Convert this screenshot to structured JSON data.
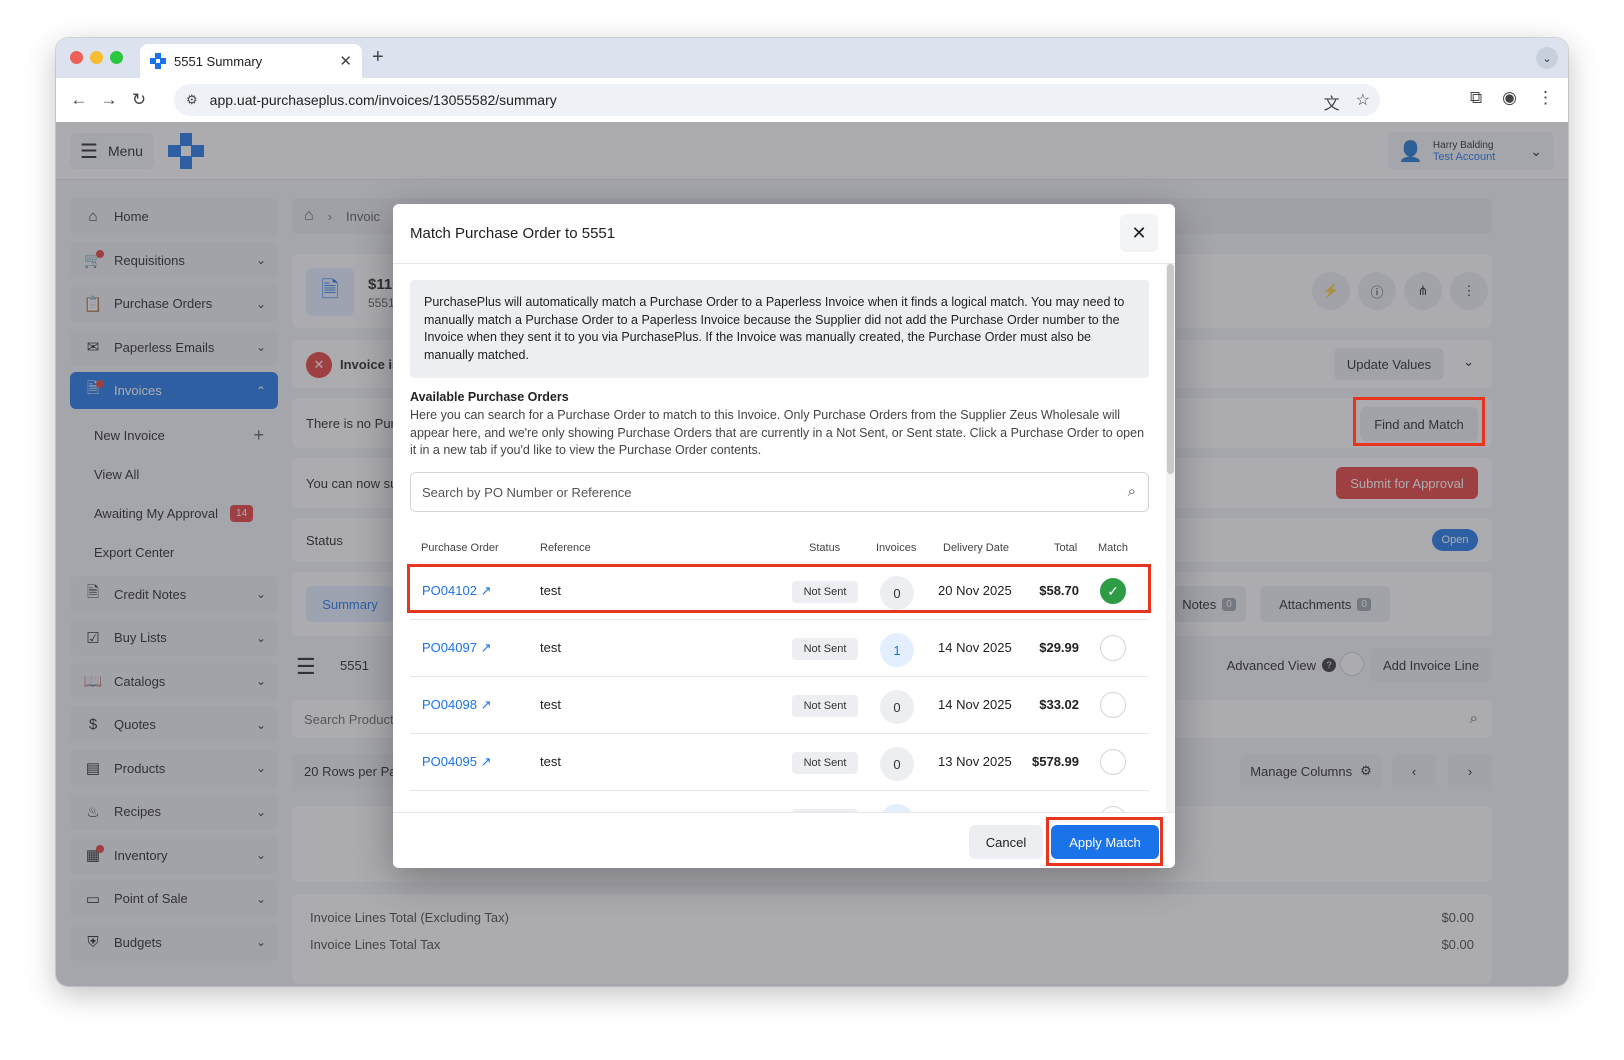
{
  "browser": {
    "tab_title": "5551 Summary",
    "url": "app.uat-purchaseplus.com/invoices/13055582/summary"
  },
  "header": {
    "menu_label": "Menu",
    "user_name": "Harry Balding",
    "user_account": "Test Account"
  },
  "sidebar": {
    "items": [
      {
        "label": "Home",
        "icon": "home-icon"
      },
      {
        "label": "Requisitions",
        "icon": "cart-icon"
      },
      {
        "label": "Purchase Orders",
        "icon": "clipboard-icon"
      },
      {
        "label": "Paperless Emails",
        "icon": "mail-icon"
      },
      {
        "label": "Invoices",
        "icon": "document-icon"
      },
      {
        "label": "Credit Notes",
        "icon": "document-icon"
      },
      {
        "label": "Buy Lists",
        "icon": "checklist-icon"
      },
      {
        "label": "Catalogs",
        "icon": "catalog-icon"
      },
      {
        "label": "Quotes",
        "icon": "dollar-icon"
      },
      {
        "label": "Products",
        "icon": "box-icon"
      },
      {
        "label": "Recipes",
        "icon": "chef-hat-icon"
      },
      {
        "label": "Inventory",
        "icon": "inventory-icon"
      },
      {
        "label": "Point of Sale",
        "icon": "pos-icon"
      },
      {
        "label": "Budgets",
        "icon": "shield-dollar-icon"
      }
    ],
    "invoice_sub": {
      "new_invoice": "New Invoice",
      "view_all": "View All",
      "awaiting": "Awaiting My Approval",
      "awaiting_count": "14",
      "export": "Export Center"
    }
  },
  "background": {
    "breadcrumb": "Invoic",
    "invoice_amount": "$110",
    "invoice_number": "5551",
    "error_text": "Invoice is",
    "update_values": "Update Values",
    "no_po_text": "There is no Pur",
    "find_and_match": "Find and Match",
    "submit_text": "You can now su",
    "submit_for_approval": "Submit for Approval",
    "status_label": "Status",
    "status_value": "Open",
    "tab_summary": "Summary",
    "tab_notes": "Notes",
    "tab_notes_count": "0",
    "tab_attachments": "Attachments",
    "tab_attachments_count": "0",
    "lines_title": "5551",
    "advanced_view": "Advanced View",
    "add_invoice_line": "Add Invoice Line",
    "search_products": "Search Products",
    "rows_per_page": "20 Rows per Pa",
    "manage_columns": "Manage Columns",
    "lines_total_label": "Invoice Lines Total (Excluding Tax)",
    "lines_total_value": "$0.00",
    "lines_tax_label": "Invoice Lines Total Tax",
    "lines_tax_value": "$0.00"
  },
  "modal": {
    "title": "Match Purchase Order to 5551",
    "info": "PurchasePlus will automatically match a Purchase Order to a Paperless Invoice when it finds a logical match. You may need to manually match a Purchase Order to a Paperless Invoice because the Supplier did not add the Purchase Order number to the Invoice when they sent it to you via PurchasePlus. If the Invoice was manually created, the Purchase Order must also be manually matched.",
    "available_title": "Available Purchase Orders",
    "available_desc": "Here you can search for a Purchase Order to match to this Invoice. Only Purchase Orders from the Supplier Zeus Wholesale will appear here, and we're only showing Purchase Orders that are currently in a Not Sent, or Sent state. Click a Purchase Order to open it in a new tab if you'd like to view the Purchase Order contents.",
    "search_placeholder": "Search by PO Number or Reference",
    "columns": {
      "po": "Purchase Order",
      "reference": "Reference",
      "status": "Status",
      "invoices": "Invoices",
      "delivery": "Delivery Date",
      "total": "Total",
      "match": "Match"
    },
    "rows": [
      {
        "po": "PO04102",
        "reference": "test",
        "status": "Not Sent",
        "invoices": "0",
        "delivery": "20 Nov 2025",
        "total": "$58.70",
        "matched": true
      },
      {
        "po": "PO04097",
        "reference": "test",
        "status": "Not Sent",
        "invoices": "1",
        "delivery": "14 Nov 2025",
        "total": "$29.99",
        "matched": false
      },
      {
        "po": "PO04098",
        "reference": "test",
        "status": "Not Sent",
        "invoices": "0",
        "delivery": "14 Nov 2025",
        "total": "$33.02",
        "matched": false
      },
      {
        "po": "PO04095",
        "reference": "test",
        "status": "Not Sent",
        "invoices": "0",
        "delivery": "13 Nov 2025",
        "total": "$578.99",
        "matched": false
      }
    ],
    "cancel_label": "Cancel",
    "apply_label": "Apply Match"
  },
  "colors": {
    "accent": "#1a73e8",
    "danger": "#e53935",
    "success": "#2e9b45",
    "highlight": "#e8361e"
  }
}
